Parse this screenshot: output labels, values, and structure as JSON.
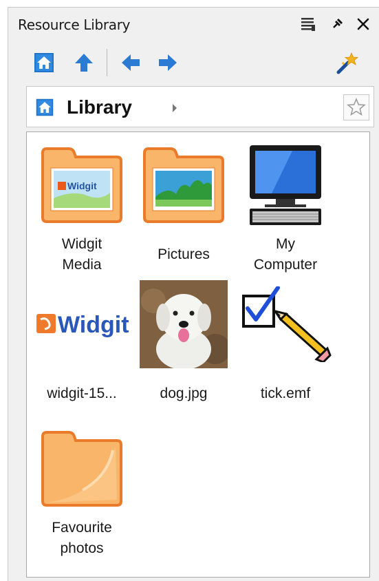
{
  "panel": {
    "title": "Resource Library",
    "title_buttons": [
      "list-icon",
      "pin-icon",
      "close-icon"
    ]
  },
  "toolbar": {
    "buttons": [
      "home-icon",
      "up-arrow-icon",
      "back-arrow-icon",
      "forward-arrow-icon",
      "magic-wand-icon"
    ]
  },
  "breadcrumb": {
    "label": "Library"
  },
  "items": [
    {
      "label": "Widgit Media",
      "line1": "Widgit",
      "line2": "Media",
      "icon": "widgit-folder-icon"
    },
    {
      "label": "Pictures",
      "line1": "Pictures",
      "line2": "",
      "icon": "pictures-folder-icon"
    },
    {
      "label": "My Computer",
      "line1": "My",
      "line2": "Computer",
      "icon": "computer-icon"
    },
    {
      "label": "widgit-15...",
      "line1": "widgit-15...",
      "line2": "",
      "icon": "widgit-logo-image"
    },
    {
      "label": "dog.jpg",
      "line1": "dog.jpg",
      "line2": "",
      "icon": "dog-photo"
    },
    {
      "label": "tick.emf",
      "line1": "tick.emf",
      "line2": "",
      "icon": "tick-pencil-icon"
    },
    {
      "label": "Favourite photos",
      "line1": "Favourite",
      "line2": "photos",
      "icon": "folder-icon"
    }
  ],
  "logo_text": "Widgit",
  "colors": {
    "accent_blue": "#2b7bd4",
    "folder_orange": "#f28a3a",
    "folder_fill": "#f9b56a"
  }
}
